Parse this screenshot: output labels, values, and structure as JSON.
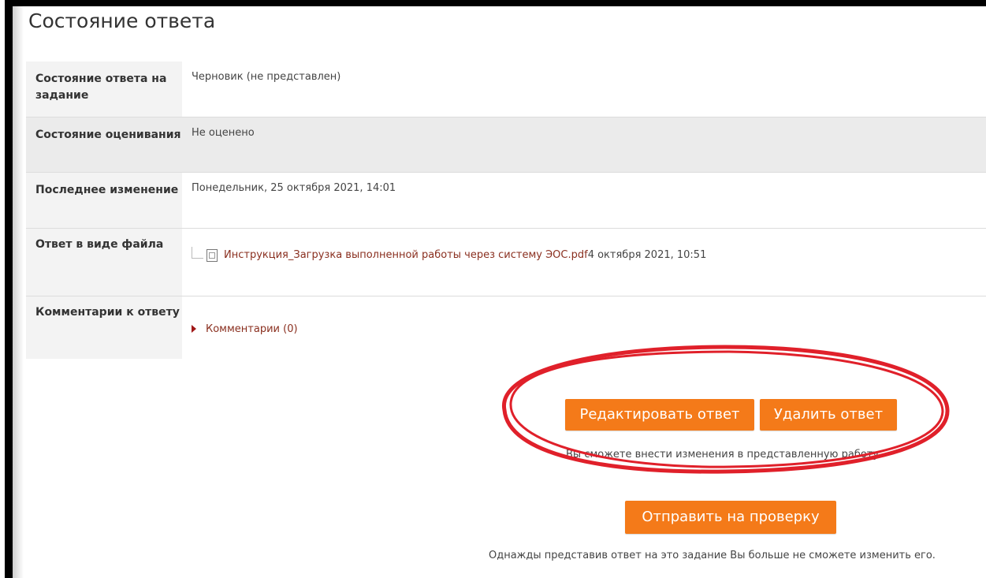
{
  "page_title": "Состояние ответа",
  "rows": [
    {
      "label": "Состояние ответа на задание",
      "value": "Черновик (не представлен)"
    },
    {
      "label": "Состояние оценивания",
      "value": "Не оценено"
    },
    {
      "label": "Последнее изменение",
      "value": "Понедельник, 25 октября 2021, 14:01"
    },
    {
      "label": "Ответ в виде файла",
      "file_name": "Инструкция_Загрузка выполненной работы через систему ЭОС.pdf",
      "file_date": "4 октября 2021, 10:51"
    },
    {
      "label": "Комментарии к ответу",
      "comments_link": "Комментарии (0)"
    }
  ],
  "buttons": {
    "edit": "Редактировать ответ",
    "delete": "Удалить ответ",
    "submit": "Отправить на проверку"
  },
  "hints": {
    "edit": "Вы сможете внести изменения в представленную работу",
    "submit": "Однажды представив ответ на это задание Вы больше не сможете изменить его."
  },
  "colors": {
    "accent_button": "#f47a19",
    "link": "#8a2f1f",
    "annotation": "#e0202a"
  }
}
